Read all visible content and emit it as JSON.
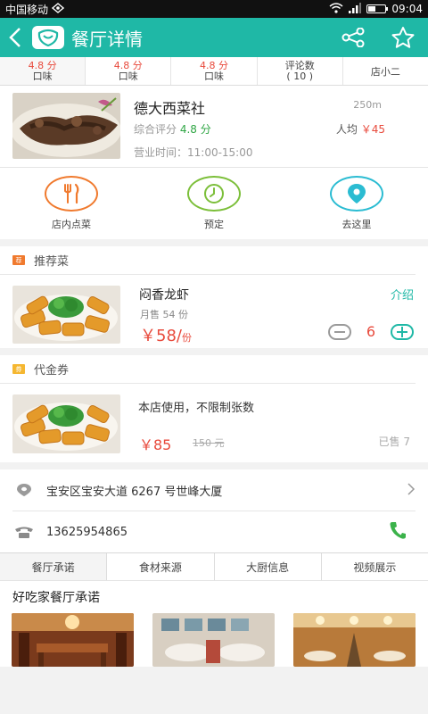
{
  "status": {
    "carrier": "中国移动",
    "time": "09:04"
  },
  "appbar": {
    "title": "餐厅详情"
  },
  "ratings": [
    {
      "value": "4.8 分",
      "label": "口味"
    },
    {
      "value": "4.8 分",
      "label": "口味"
    },
    {
      "value": "4.8 分",
      "label": "口味"
    },
    {
      "value": "评论数",
      "label": "( 10 )"
    },
    {
      "value": "",
      "label": "店小二"
    }
  ],
  "restaurant": {
    "name": "德大西菜社",
    "distance": "250m",
    "score_label": "综合评分",
    "score": "4.8 分",
    "avg_label": "人均",
    "avg_price": "￥45",
    "hours": "营业时间：11:00-15:00"
  },
  "actions": [
    {
      "label": "店内点菜",
      "color": "#f07a2e"
    },
    {
      "label": "预定",
      "color": "#7cbf3a"
    },
    {
      "label": "去这里",
      "color": "#2bbcd2"
    }
  ],
  "recommend": {
    "tag": "荐",
    "title": "推荐菜",
    "dish": {
      "name": "闷香龙虾",
      "intro": "介绍",
      "sold": "月售 54 份",
      "price": "￥58/",
      "unit": "份",
      "qty": "6"
    }
  },
  "voucher": {
    "tag": "券",
    "title": "代金券",
    "desc": "本店使用，不限制张数",
    "price": "￥85",
    "orig_price": "150 元",
    "sold": "已售 7"
  },
  "address": "宝安区宝安大道 6267 号世峰大厦",
  "phone": "13625954865",
  "tabs": [
    "餐厅承诺",
    "食材来源",
    "大厨信息",
    "视频展示"
  ],
  "promise": {
    "title": "好吃家餐厅承诺"
  },
  "colors": {
    "brand": "#1fb8a6",
    "price": "#e84a3c",
    "score": "#2fa644",
    "recommend_tag": "#f07a2e",
    "voucher_tag": "#f5b731"
  }
}
